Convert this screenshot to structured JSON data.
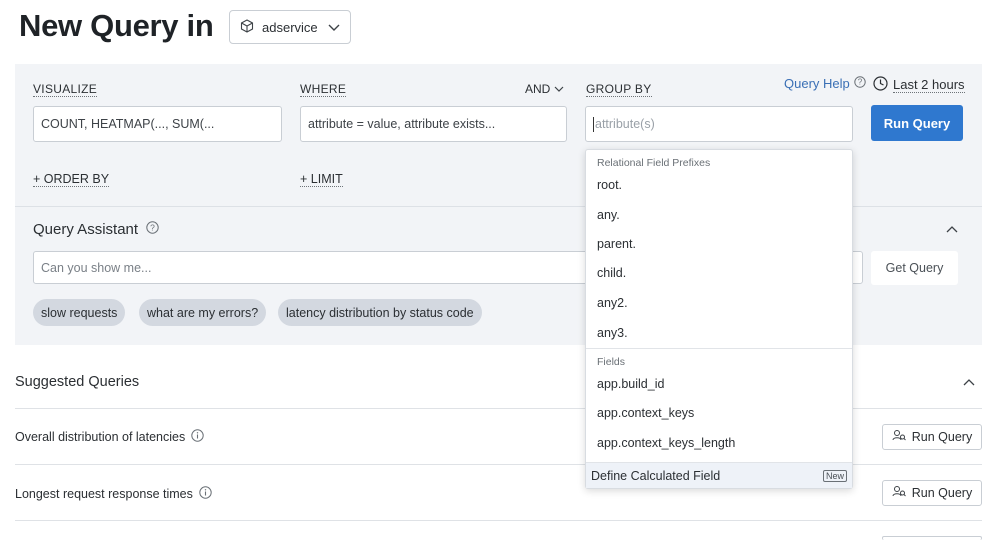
{
  "header": {
    "title": "New Query in",
    "dataset": "adservice"
  },
  "builder": {
    "visualize": {
      "label": "VISUALIZE",
      "value": "COUNT, HEATMAP(..., SUM(..."
    },
    "where": {
      "label": "WHERE",
      "value": "attribute = value, attribute exists...",
      "and_toggle": "AND"
    },
    "group_by": {
      "label": "GROUP BY",
      "placeholder": "attribute(s)"
    },
    "query_help": "Query Help",
    "time_range": "Last 2 hours",
    "run_query": "Run Query",
    "order_by": "+ ORDER BY",
    "limit": "+ LIMIT"
  },
  "assistant": {
    "title": "Query Assistant",
    "placeholder": "Can you show me...",
    "get_query": "Get Query",
    "chips": [
      "slow requests",
      "what are my errors?",
      "latency distribution by status code"
    ]
  },
  "suggested": {
    "title": "Suggested Queries",
    "rows": [
      {
        "label": "Overall distribution of latencies",
        "button": "Run Query"
      },
      {
        "label": "Longest request response times",
        "button": "Run Query"
      }
    ]
  },
  "dropdown": {
    "section1": "Relational Field Prefixes",
    "prefixes": [
      "root.",
      "any.",
      "parent.",
      "child.",
      "any2.",
      "any3."
    ],
    "section2": "Fields",
    "fields": [
      "app.build_id",
      "app.context_keys",
      "app.context_keys_length"
    ],
    "footer": "Define Calculated Field",
    "footer_badge": "New"
  },
  "colors": {
    "accent": "#2f78cf",
    "panel_bg": "#f2f4f7",
    "chip_bg": "#d3d8e0",
    "link": "#3a6fb5"
  }
}
